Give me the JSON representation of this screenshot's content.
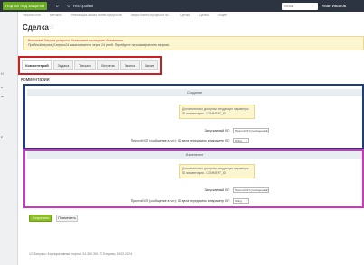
{
  "topbar": {
    "portal_button": "Портал под защитой",
    "counter": "0",
    "settings": "Настройки",
    "search_placeholder": "поиск",
    "user": "Иван Иванов"
  },
  "sidebar": {
    "items": [
      "",
      "Н",
      "а",
      "ш",
      "к"
    ]
  },
  "breadcrumb": [
    "Рабочий стол",
    "Контакты",
    "Реализация заказа бизнес-процессов",
    "Запуск бизнес-процессов по...",
    "Сделка",
    "Сделки",
    "Общее"
  ],
  "page": {
    "title": "Сделка"
  },
  "notice": {
    "line1": "Внимание! Версия устарела. Установите последние обновления.",
    "line2": "Пробный период Битрикс24 заканчивается через 24 дней. Перейдите на коммерческую версию."
  },
  "tabs": [
    "Комментарий",
    "Задача",
    "Письмо",
    "Встреча",
    "Звонок",
    "Визит"
  ],
  "section_heading": "Комментарии",
  "section1": {
    "header": "Создание",
    "info_line1": "Дополнительно доступны следующие параметры:",
    "info_line2": "ID комментария - COMMENT_ID",
    "field1_label": "Запускаемый БП:",
    "field1_value": "Простой БП (сообщение в чат)",
    "field2_label": "Простой БП (сообщение в чат): ID дела передавать в параметр БП:",
    "field2_value": "String"
  },
  "section2": {
    "header": "Изменение",
    "info_line1": "Дополнительно доступны следующие параметры:",
    "info_line2": "ID комментария - COMMENT_ID",
    "field1_label": "Запускаемый БП:",
    "field1_value": "Простой БП (сообщение в чат)",
    "field2_label": "Простой БП (сообщение в чат): ID дела передавать в параметр БП:",
    "field2_value": "String"
  },
  "buttons": {
    "save": "Сохранить",
    "apply": "Применить"
  },
  "footer": {
    "copyright": "1С-Битрикс: Корпоративный портал 24.300.300, © Битрикс, 2002-2024"
  }
}
